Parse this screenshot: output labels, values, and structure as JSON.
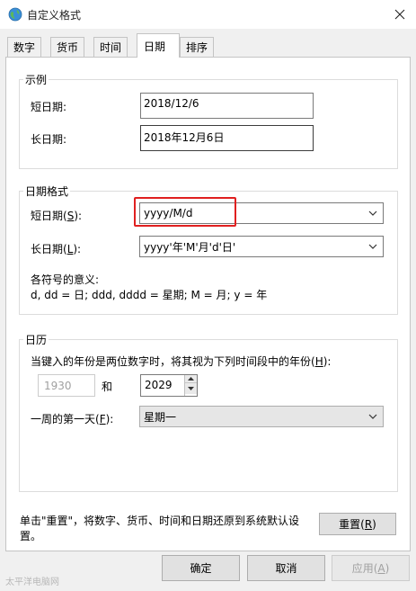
{
  "window": {
    "title": "自定义格式",
    "icon": "globe-icon",
    "close_icon": "close-icon"
  },
  "tabs": [
    {
      "label": "数字",
      "active": false
    },
    {
      "label": "货币",
      "active": false
    },
    {
      "label": "时间",
      "active": false
    },
    {
      "label": "日期",
      "active": true
    },
    {
      "label": "排序",
      "active": false
    }
  ],
  "example": {
    "group_label": "示例",
    "short_label": "短日期:",
    "short_value": "2018/12/6",
    "long_label": "长日期:",
    "long_value": "2018年12月6日"
  },
  "date_format": {
    "group_label": "日期格式",
    "short_label": "短日期(",
    "short_access_key": "S",
    "short_label_end": "):",
    "short_value": "yyyy/M/d",
    "long_label": "长日期(",
    "long_access_key": "L",
    "long_label_end": "):",
    "long_value": "yyyy'年'M'月'd'日'",
    "symbols_title": "各符号的意义:",
    "symbols_text": "d, dd = 日;  ddd, dddd = 星期;  M = 月;  y = 年"
  },
  "calendar": {
    "group_label": "日历",
    "two_digit_text": "当键入的年份是两位数字时，将其视为下列时间段中的年份(",
    "two_digit_key": "H",
    "two_digit_end": "):",
    "from_year": "1930",
    "and_label": "和",
    "to_year": "2029",
    "first_day_label": "一周的第一天(",
    "first_day_key": "F",
    "first_day_end": "):",
    "first_day_value": "星期一"
  },
  "reset": {
    "text_line1": "单击\"重置\"，将数字、货币、时间和日期还原到系统默认设",
    "text_line2": "置。",
    "button_label": "重置(",
    "button_key": "R",
    "button_end": ")"
  },
  "footer": {
    "ok_label": "确定",
    "cancel_label": "取消",
    "apply_label": "应用(",
    "apply_key": "A",
    "apply_end": ")"
  },
  "watermark": "太平洋电脑网",
  "colors": {
    "highlight": "#e02020",
    "window_bg": "#f0f0f0",
    "panel_bg": "#ffffff"
  }
}
